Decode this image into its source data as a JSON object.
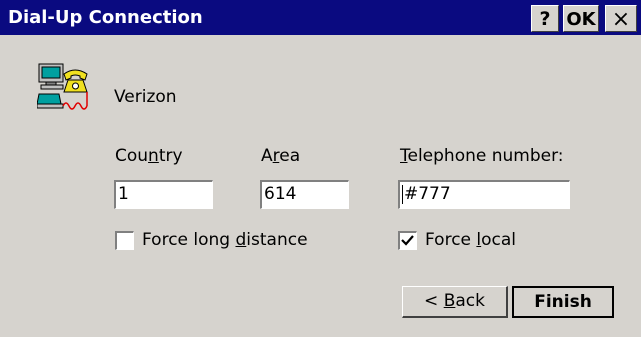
{
  "window": {
    "title": "Dial-Up Connection",
    "help_label": "?",
    "ok_label": "OK",
    "close_label": "×"
  },
  "connection": {
    "icon": "dialup-connection-icon",
    "name": "Verizon"
  },
  "fields": {
    "country_label": "Country",
    "country_value": "1",
    "area_label": "Area",
    "area_value": "614",
    "phone_label": "Telephone number:",
    "phone_value": "#777"
  },
  "options": {
    "force_long_distance": {
      "label": "Force long distance",
      "checked": false
    },
    "force_local": {
      "label": "Force local",
      "checked": true
    }
  },
  "buttons": {
    "back_label": "< Back",
    "finish_label": "Finish"
  }
}
